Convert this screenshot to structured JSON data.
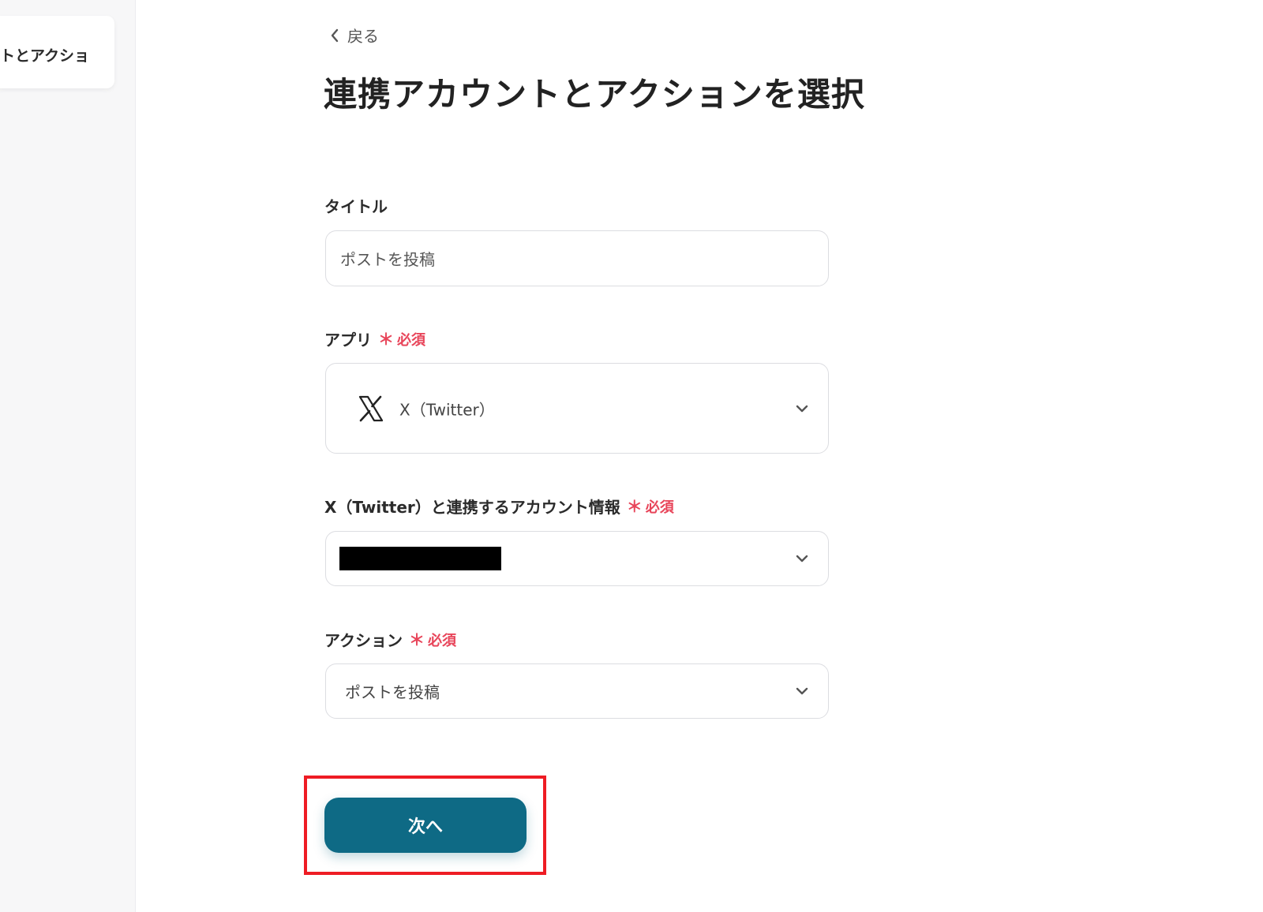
{
  "sidebar": {
    "step_label": "トとアクショ"
  },
  "header": {
    "back_label": "戻る",
    "title": "連携アカウントとアクションを選択"
  },
  "form": {
    "title_field": {
      "label": "タイトル",
      "value": "ポストを投稿"
    },
    "app_field": {
      "label": "アプリ",
      "required_mark": "＊",
      "required_text": "必須",
      "value": "X（Twitter）",
      "icon": "x-logo-icon"
    },
    "account_field": {
      "label": "X（Twitter）と連携するアカウント情報",
      "required_mark": "＊",
      "required_text": "必須",
      "value_redacted": true
    },
    "action_field": {
      "label": "アクション",
      "required_mark": "＊",
      "required_text": "必須",
      "value": "ポストを投稿"
    }
  },
  "footer": {
    "next_label": "次へ"
  },
  "colors": {
    "primary_button": "#0e6a85",
    "required": "#e8455a",
    "highlight": "#ee1c24"
  }
}
